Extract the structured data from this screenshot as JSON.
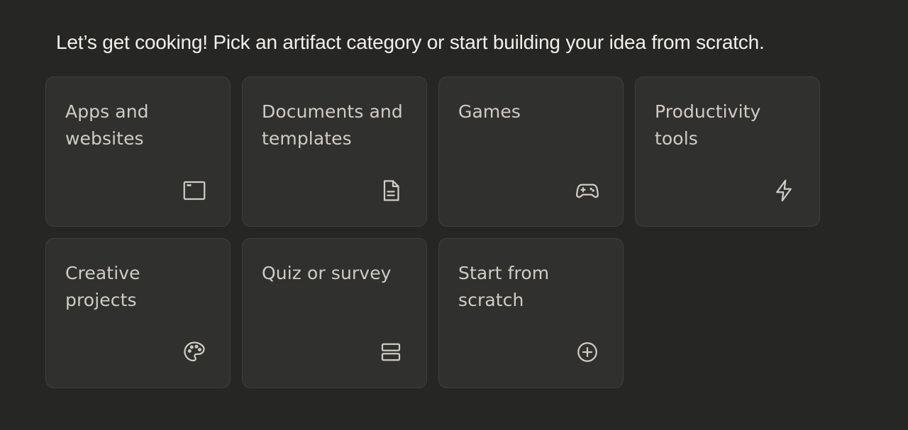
{
  "intro": {
    "text": "Let’s get cooking! Pick an artifact category or start building your idea from scratch."
  },
  "cards": [
    {
      "label": "Apps and websites",
      "icon": "app-window-icon"
    },
    {
      "label": "Documents and templates",
      "icon": "document-icon"
    },
    {
      "label": "Games",
      "icon": "gamepad-icon"
    },
    {
      "label": "Productivity tools",
      "icon": "lightning-icon"
    },
    {
      "label": "Creative projects",
      "icon": "palette-icon"
    },
    {
      "label": "Quiz or survey",
      "icon": "rows-icon"
    },
    {
      "label": "Start from scratch",
      "icon": "plus-circle-icon"
    }
  ],
  "colors": {
    "background": "#262624",
    "card": "#30302e",
    "card_border": "#3e3e3b",
    "text": "#cfccc3"
  }
}
